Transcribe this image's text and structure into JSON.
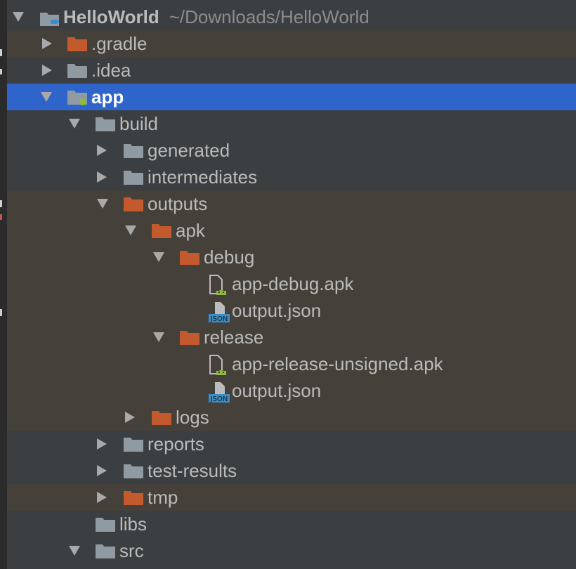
{
  "colors": {
    "background": "#3c3f41",
    "selection": "#2f65ca",
    "excluded_row": "#45403a",
    "folder_gray": "#909aa3",
    "folder_orange": "#c25a2d",
    "android_green": "#8dbb3b",
    "json_blue": "#3a8ec7"
  },
  "tree": {
    "root": {
      "label": "HelloWorld",
      "path": "~/Downloads/HelloWorld",
      "icon": "project-folder-icon"
    },
    "items": [
      {
        "label": ".gradle",
        "icon": "folder-orange-icon",
        "state": "collapsed"
      },
      {
        "label": ".idea",
        "icon": "folder-gray-icon",
        "state": "collapsed"
      },
      {
        "label": "app",
        "icon": "module-folder-icon",
        "state": "expanded",
        "selected": true
      },
      {
        "label": "build",
        "icon": "folder-gray-icon",
        "state": "expanded"
      },
      {
        "label": "generated",
        "icon": "folder-gray-icon",
        "state": "collapsed"
      },
      {
        "label": "intermediates",
        "icon": "folder-gray-icon",
        "state": "collapsed"
      },
      {
        "label": "outputs",
        "icon": "folder-orange-icon",
        "state": "expanded"
      },
      {
        "label": "apk",
        "icon": "folder-orange-icon",
        "state": "expanded"
      },
      {
        "label": "debug",
        "icon": "folder-orange-icon",
        "state": "expanded"
      },
      {
        "label": "app-debug.apk",
        "icon": "apk-file-icon",
        "state": "leaf"
      },
      {
        "label": "output.json",
        "icon": "json-file-icon",
        "state": "leaf"
      },
      {
        "label": "release",
        "icon": "folder-orange-icon",
        "state": "expanded"
      },
      {
        "label": "app-release-unsigned.apk",
        "icon": "apk-file-icon",
        "state": "leaf"
      },
      {
        "label": "output.json",
        "icon": "json-file-icon",
        "state": "leaf"
      },
      {
        "label": "logs",
        "icon": "folder-orange-icon",
        "state": "collapsed"
      },
      {
        "label": "reports",
        "icon": "folder-gray-icon",
        "state": "collapsed"
      },
      {
        "label": "test-results",
        "icon": "folder-gray-icon",
        "state": "collapsed"
      },
      {
        "label": "tmp",
        "icon": "folder-orange-icon",
        "state": "collapsed"
      },
      {
        "label": "libs",
        "icon": "folder-gray-icon",
        "state": "leaf"
      },
      {
        "label": "src",
        "icon": "folder-gray-icon",
        "state": "expanded"
      }
    ]
  },
  "json_badge": "JSON"
}
